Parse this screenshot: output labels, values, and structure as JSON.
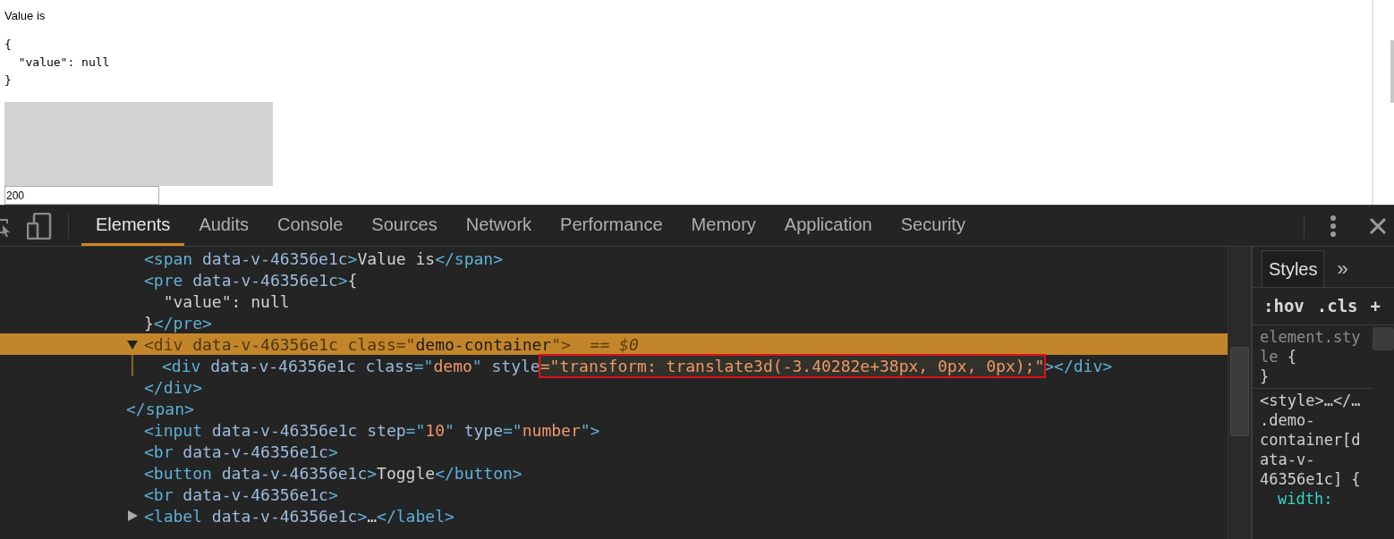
{
  "page": {
    "label": "Value is",
    "json_text": "{\n  \"value\": null\n}",
    "number_input": {
      "value": "200"
    }
  },
  "devtools": {
    "tabs": [
      {
        "label": "Elements",
        "selected": true
      },
      {
        "label": "Audits",
        "selected": false
      },
      {
        "label": "Console",
        "selected": false
      },
      {
        "label": "Sources",
        "selected": false
      },
      {
        "label": "Network",
        "selected": false
      },
      {
        "label": "Performance",
        "selected": false
      },
      {
        "label": "Memory",
        "selected": false
      },
      {
        "label": "Application",
        "selected": false
      },
      {
        "label": "Security",
        "selected": false
      }
    ],
    "dom_tree": [
      {
        "children": [
          {
            "selected": false,
            "lines": [
              [
                {
                  "kind": "tag",
                  "text": "<span"
                },
                {
                  "kind": "attr",
                  "text": " data-v-46356e1c"
                },
                {
                  "kind": "tag",
                  "text": ">"
                },
                {
                  "kind": "text",
                  "text": "Value is"
                },
                {
                  "kind": "tag",
                  "text": "</span>"
                }
              ]
            ]
          },
          {
            "selected": false,
            "lines": [
              [
                {
                  "kind": "tag",
                  "text": "<pre"
                },
                {
                  "kind": "attr",
                  "text": " data-v-46356e1c"
                },
                {
                  "kind": "tag",
                  "text": ">"
                },
                {
                  "kind": "text",
                  "text": "{"
                }
              ],
              [
                {
                  "kind": "text",
                  "text": "  \"value\": null"
                }
              ],
              [
                {
                  "kind": "text",
                  "text": "}"
                },
                {
                  "kind": "tag",
                  "text": "</pre>"
                }
              ]
            ]
          },
          {
            "selected": true,
            "expanded": true,
            "badge": "== $0",
            "lines": [
              [
                {
                  "kind": "tag",
                  "text": "<div"
                },
                {
                  "kind": "attr",
                  "text": " data-v-46356e1c"
                },
                {
                  "kind": "attr",
                  "text": " class"
                },
                {
                  "kind": "tag",
                  "text": "=\""
                },
                {
                  "kind": "value",
                  "text": "demo-container"
                },
                {
                  "kind": "tag",
                  "text": "\">"
                }
              ]
            ],
            "children": [
              {
                "selected": false,
                "lines": [
                  [
                    {
                      "kind": "tag",
                      "text": "<div"
                    },
                    {
                      "kind": "attr",
                      "text": " data-v-46356e1c"
                    },
                    {
                      "kind": "attr",
                      "text": " class"
                    },
                    {
                      "kind": "tag",
                      "text": "=\""
                    },
                    {
                      "kind": "value",
                      "text": "demo"
                    },
                    {
                      "kind": "tag",
                      "text": "\""
                    },
                    {
                      "kind": "attr",
                      "text": " style"
                    },
                    {
                      "kind": "value",
                      "text": "=\"transform: translate3d(-3.40282e+38px, 0px, 0px);\"",
                      "outlined": true
                    },
                    {
                      "kind": "tag",
                      "text": "></div>"
                    }
                  ]
                ]
              }
            ],
            "closing": [
              {
                "kind": "tag",
                "text": "</div>"
              }
            ]
          }
        ],
        "closing": [
          {
            "kind": "tag",
            "text": "</span>"
          }
        ]
      },
      {
        "selected": false,
        "lines": [
          [
            {
              "kind": "tag",
              "text": "<input"
            },
            {
              "kind": "attr",
              "text": " data-v-46356e1c"
            },
            {
              "kind": "attr",
              "text": " step"
            },
            {
              "kind": "tag",
              "text": "=\""
            },
            {
              "kind": "value",
              "text": "10"
            },
            {
              "kind": "tag",
              "text": "\""
            },
            {
              "kind": "attr",
              "text": " type"
            },
            {
              "kind": "tag",
              "text": "=\""
            },
            {
              "kind": "value",
              "text": "number"
            },
            {
              "kind": "tag",
              "text": "\">"
            }
          ]
        ]
      },
      {
        "selected": false,
        "lines": [
          [
            {
              "kind": "tag",
              "text": "<br"
            },
            {
              "kind": "attr",
              "text": " data-v-46356e1c"
            },
            {
              "kind": "tag",
              "text": ">"
            }
          ]
        ]
      },
      {
        "selected": false,
        "lines": [
          [
            {
              "kind": "tag",
              "text": "<button"
            },
            {
              "kind": "attr",
              "text": " data-v-46356e1c"
            },
            {
              "kind": "tag",
              "text": ">"
            },
            {
              "kind": "text",
              "text": "Toggle"
            },
            {
              "kind": "tag",
              "text": "</button>"
            }
          ]
        ]
      },
      {
        "selected": false,
        "lines": [
          [
            {
              "kind": "tag",
              "text": "<br"
            },
            {
              "kind": "attr",
              "text": " data-v-46356e1c"
            },
            {
              "kind": "tag",
              "text": ">"
            }
          ]
        ]
      },
      {
        "selected": false,
        "expanded": false,
        "lines": [
          [
            {
              "kind": "tag",
              "text": "<label"
            },
            {
              "kind": "attr",
              "text": " data-v-46356e1c"
            },
            {
              "kind": "tag",
              "text": ">"
            },
            {
              "kind": "text",
              "text": "…"
            },
            {
              "kind": "tag",
              "text": "</label>"
            }
          ]
        ]
      }
    ],
    "styles_pane": {
      "tabs": [
        {
          "label": "Styles",
          "selected": true
        }
      ],
      "more_label": "»",
      "filter_buttons": [
        ":hov",
        ".cls",
        "+"
      ],
      "rules": [
        {
          "selector": "element.style",
          "open": " {",
          "close": "}"
        },
        {
          "source": "<style>…</…",
          "selector": ".demo-container[data-v-46356e1c]",
          "open": " {",
          "declarations": [
            "width:"
          ]
        }
      ]
    }
  }
}
